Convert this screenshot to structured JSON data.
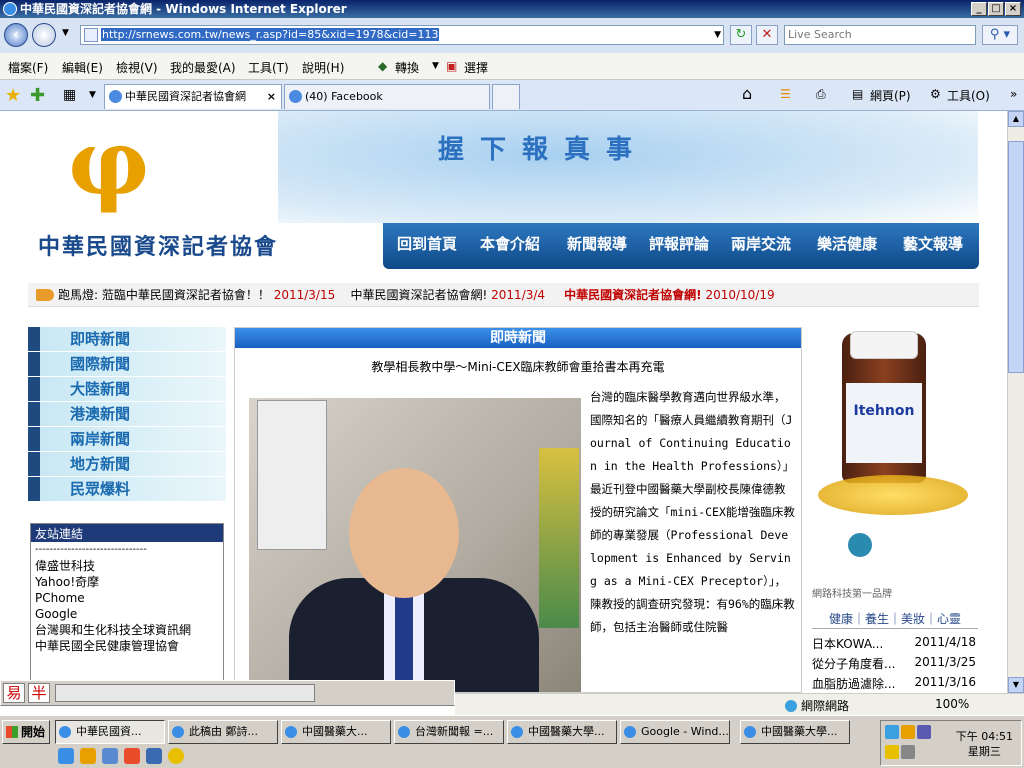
{
  "window": {
    "title": "中華民國資深記者協會網 - Windows Internet Explorer"
  },
  "address": {
    "url": "http://srnews.com.tw/news_r.asp?id=85&xid=1978&cid=113",
    "search_placeholder": "Live Search"
  },
  "menu": [
    "檔案(F)",
    "編輯(E)",
    "檢視(V)",
    "我的最愛(A)",
    "工具(T)",
    "說明(H)"
  ],
  "toolbar": {
    "convert": "轉換",
    "select": "選擇",
    "home_page": "網頁(P)",
    "tools": "工具(O)"
  },
  "tabs": [
    {
      "label": "中華民國資深記者協會網"
    },
    {
      "label": "(40) Facebook"
    }
  ],
  "banner": {
    "slogan": "握下報真事",
    "org_name": "中華民國資深記者協會",
    "nav": [
      "回到首頁",
      "本會介紹",
      "新聞報導",
      "評報評論",
      "兩岸交流",
      "樂活健康",
      "藝文報導"
    ]
  },
  "ticker": {
    "prefix": "跑馬燈:",
    "items": [
      {
        "text": "蒞臨中華民國資深記者協會！！",
        "date": "2011/3/15"
      },
      {
        "text": "中華民國資深記者協會網!",
        "date": "2011/3/4"
      },
      {
        "text": "中華民國資深記者協會網!",
        "date": "2010/10/19"
      }
    ]
  },
  "left_nav": [
    "即時新聞",
    "國際新聞",
    "大陸新聞",
    "港澳新聞",
    "兩岸新聞",
    "地方新聞",
    "民眾爆料"
  ],
  "friends": {
    "title": "友站連結",
    "divider": "-------------------------------",
    "links": [
      "偉盛世科技",
      "Yahoo!奇摩",
      "PChome",
      "Google",
      "台灣興和生化科技全球資訊網",
      "中華民國全民健康管理協會"
    ]
  },
  "news": {
    "section": "即時新聞",
    "headline": "教學相長教中學～Mini-CEX臨床教師會重拾書本再充電",
    "body": "台灣的臨床醫學教育邁向世界級水準，國際知名的「醫療人員繼續教育期刊（Journal of Continuing Education in the Health Professions）」最近刊登中國醫藥大學副校長陳偉德教授的研究論文「mini-CEX能增強臨床教師的專業發展（Professional Development is Enhanced by Serving as a Mini-CEX Preceptor）」，陳教授的調查研究發現：有96%的臨床教師，包括主治醫師或住院醫"
  },
  "ad": {
    "product": "Itehnon",
    "slogan": "網路科技第一品牌",
    "tabs": "健康｜養生｜美妝｜心靈",
    "list": [
      {
        "text": "日本KOWA...",
        "date": "2011/4/18"
      },
      {
        "text": "從分子角度看...",
        "date": "2011/3/25"
      },
      {
        "text": "血脂肪過濾除...",
        "date": "2011/3/16"
      }
    ]
  },
  "ime": {
    "k1": "易",
    "k2": "半"
  },
  "status": {
    "zone": "網際網路",
    "zoom": "100%"
  },
  "taskbar": {
    "start": "開始",
    "buttons": [
      "中華民國資...",
      "此稿由 鄭詩...",
      "中國醫藥大...",
      "台灣新聞報 =...",
      "中國醫藥大學...",
      "Google - Wind...",
      "中國醫藥大學..."
    ],
    "time": "下午 04:51",
    "day": "星期三"
  },
  "colors": {
    "accent": "#1a4a8c",
    "ticker_date": "#c00000",
    "nav_bg": "#0e4a88"
  }
}
